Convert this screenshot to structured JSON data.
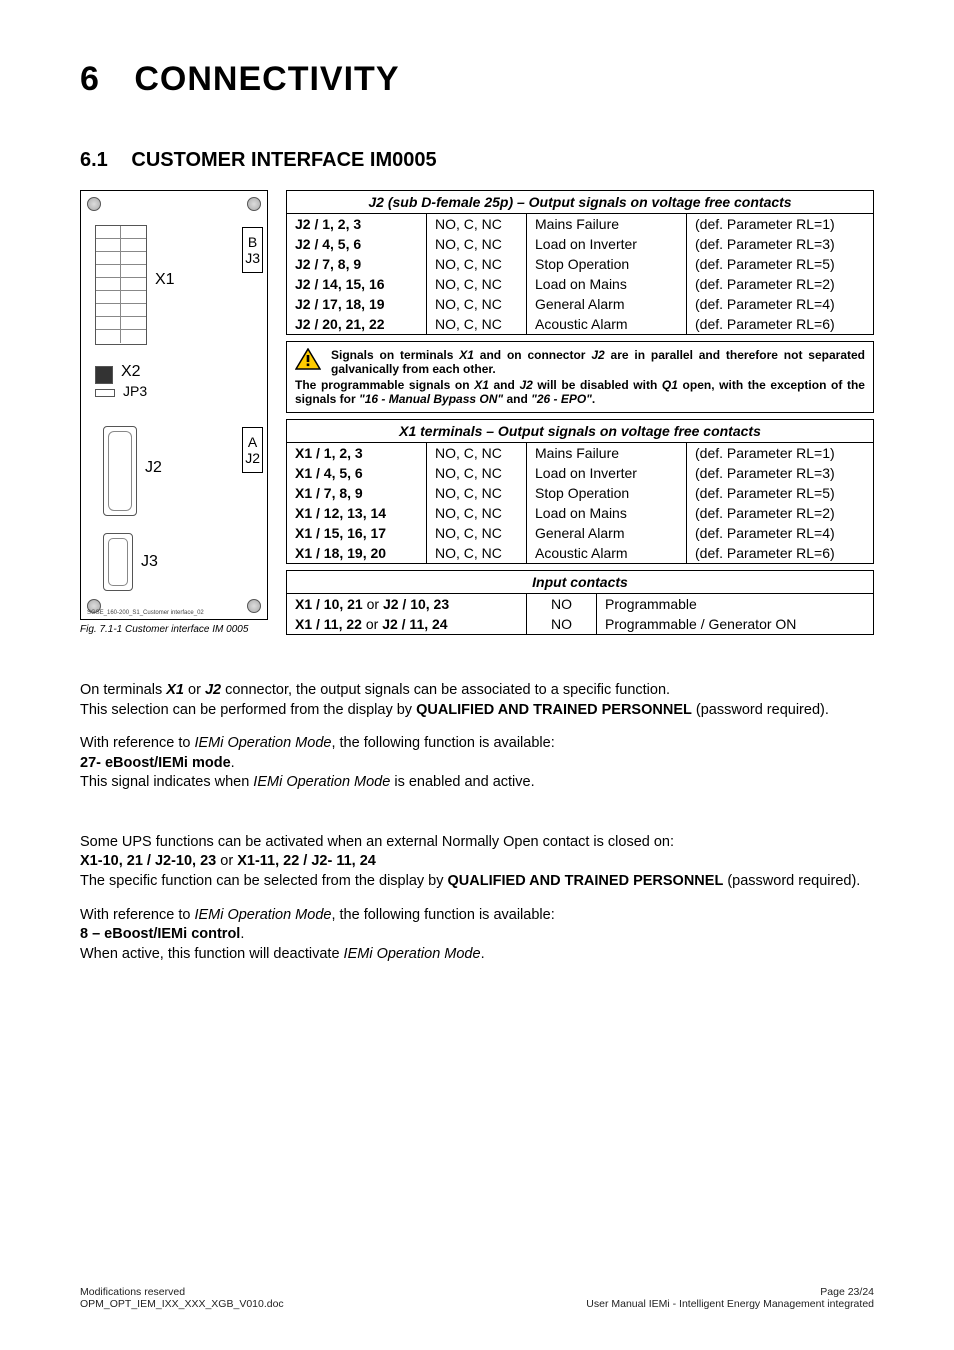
{
  "chapter": {
    "number": "6",
    "title": "CONNECTIVITY"
  },
  "section": {
    "number": "6.1",
    "title": "CUSTOMER INTERFACE IM0005"
  },
  "figure": {
    "labels": {
      "x1": "X1",
      "x2": "X2",
      "jp3": "JP3",
      "j2": "J2",
      "j3": "J3",
      "sideB": "B\nJ3",
      "sideA": "A\nJ2"
    },
    "fine_print": "SGSE_160-200_S1_Customer interface_02",
    "caption": "Fig. 7.1-1   Customer interface IM 0005"
  },
  "table_j2": {
    "header": "J2 (sub D-female 25p) – Output signals on voltage free contacts",
    "rows": [
      {
        "a": "J2 / 1, 2, 3",
        "b": "NO, C, NC",
        "c": "Mains Failure",
        "d": "(def. Parameter RL=1)"
      },
      {
        "a": "J2 / 4, 5, 6",
        "b": "NO, C, NC",
        "c": "Load on Inverter",
        "d": "(def. Parameter RL=3)"
      },
      {
        "a": "J2 / 7, 8, 9",
        "b": "NO, C, NC",
        "c": "Stop Operation",
        "d": "(def. Parameter RL=5)"
      },
      {
        "a": "J2 / 14, 15, 16",
        "b": "NO, C, NC",
        "c": "Load on Mains",
        "d": "(def. Parameter RL=2)"
      },
      {
        "a": "J2 / 17, 18, 19",
        "b": "NO, C, NC",
        "c": "General Alarm",
        "d": "(def. Parameter RL=4)"
      },
      {
        "a": "J2 / 20, 21, 22",
        "b": "NO, C, NC",
        "c": "Acoustic Alarm",
        "d": "(def. Parameter RL=6)"
      }
    ]
  },
  "warning": {
    "line1_a": "Signals on terminals ",
    "line1_b": "X1",
    "line1_c": " and on connector ",
    "line1_d": "J2",
    "line1_e": " are in parallel and therefore not separated galvanically from each other.",
    "line2_a": "The programmable signals on ",
    "line2_b": "X1",
    "line2_c": " and ",
    "line2_d": "J2",
    "line2_e": " will be disabled with ",
    "line2_f": "Q1",
    "line2_g": " open, with the exception of the signals for ",
    "line2_h": "\"16 - Manual Bypass ON\"",
    "line2_i": " and ",
    "line2_j": "\"26 - EPO\"",
    "line2_k": "."
  },
  "table_x1": {
    "header": "X1 terminals – Output signals on voltage free contacts",
    "rows": [
      {
        "a": "X1 / 1, 2, 3",
        "b": "NO, C, NC",
        "c": "Mains Failure",
        "d": "(def. Parameter RL=1)"
      },
      {
        "a": "X1 / 4, 5, 6",
        "b": "NO, C, NC",
        "c": "Load on Inverter",
        "d": "(def. Parameter RL=3)"
      },
      {
        "a": "X1 / 7, 8, 9",
        "b": "NO, C, NC",
        "c": "Stop Operation",
        "d": "(def. Parameter RL=5)"
      },
      {
        "a": "X1 / 12, 13, 14",
        "b": "NO, C, NC",
        "c": "Load on Mains",
        "d": "(def. Parameter RL=2)"
      },
      {
        "a": "X1 / 15, 16, 17",
        "b": "NO, C, NC",
        "c": "General Alarm",
        "d": "(def. Parameter RL=4)"
      },
      {
        "a": "X1 / 18, 19, 20",
        "b": "NO, C, NC",
        "c": "Acoustic Alarm",
        "d": "(def. Parameter RL=6)"
      }
    ]
  },
  "table_input": {
    "header": "Input contacts",
    "rows": [
      {
        "a1": "X1 / 10, 21",
        "or1": " or ",
        "a2": "J2 / 10, 23",
        "b": "NO",
        "c": "Programmable"
      },
      {
        "a1": "X1 / 11, 22",
        "or1": " or ",
        "a2": "J2 / 11, 24",
        "b": "NO",
        "c": "Programmable / Generator ON"
      }
    ]
  },
  "body": {
    "p1_a": "On terminals ",
    "p1_b": "X1",
    "p1_c": " or ",
    "p1_d": "J2",
    "p1_e": " connector, the output signals can be associated to a specific function.",
    "p1_f": "This selection can be performed from the display by ",
    "p1_g": "QUALIFIED AND TRAINED PERSONNEL",
    "p1_h": " (password required).",
    "p2_a": "With reference to ",
    "p2_b": "IEMi Operation Mode",
    "p2_c": ", the following function is available:",
    "p2_d": "27- eBoost/IEMi mode",
    "p2_e": ".",
    "p2_f": "This signal indicates when ",
    "p2_g": "IEMi Operation Mode",
    "p2_h": " is enabled and active.",
    "p3_a": "Some UPS functions can be activated when an external Normally Open contact is closed on:",
    "p3_b": "X1-10, 21 / J2-10, 23",
    "p3_b2": " or ",
    "p3_c": "X1-11, 22 / J2- 11, 24",
    "p3_d": "The specific function can be selected from the display by ",
    "p3_e": "QUALIFIED AND TRAINED PERSONNEL",
    "p3_f": " (password required).",
    "p4_a": "With reference to ",
    "p4_b": "IEMi Operation Mode",
    "p4_c": ", the following function is available:",
    "p4_d": "8 – eBoost/IEMi control",
    "p4_e": ".",
    "p4_f": "When active, this function will deactivate ",
    "p4_g": "IEMi Operation Mode",
    "p4_h": "."
  },
  "footer": {
    "left1": "Modifications reserved",
    "left2": "OPM_OPT_IEM_IXX_XXX_XGB_V010.doc",
    "right1": "Page 23/24",
    "right2": "User Manual IEMi - Intelligent Energy Management integrated"
  }
}
